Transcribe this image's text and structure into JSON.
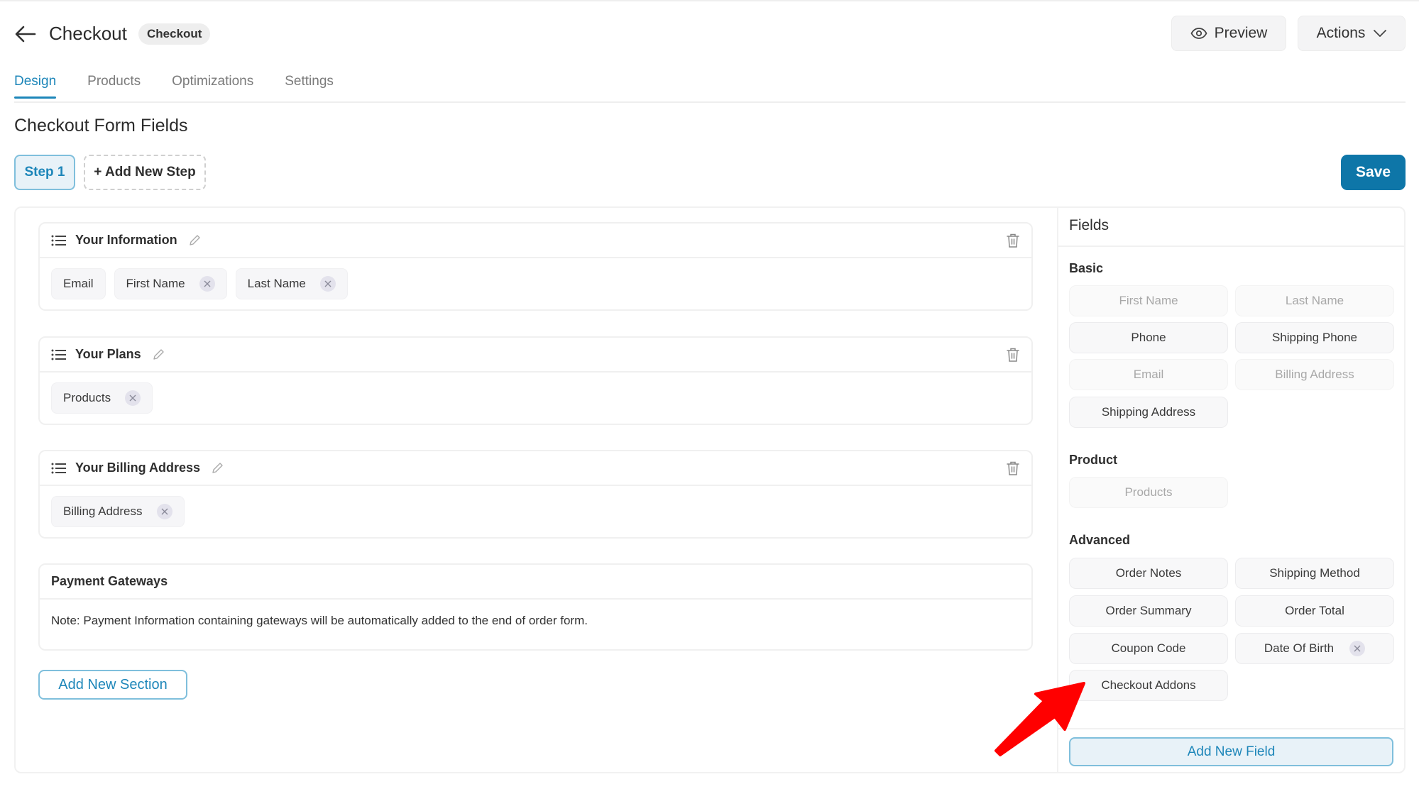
{
  "header": {
    "title": "Checkout",
    "badge": "Checkout",
    "preview_label": "Preview",
    "actions_label": "Actions"
  },
  "tabs": [
    {
      "label": "Design",
      "active": true
    },
    {
      "label": "Products",
      "active": false
    },
    {
      "label": "Optimizations",
      "active": false
    },
    {
      "label": "Settings",
      "active": false
    }
  ],
  "form": {
    "heading": "Checkout Form Fields",
    "step_label": "Step 1",
    "add_step_label": "+ Add New Step",
    "save_label": "Save",
    "sections": [
      {
        "title": "Your Information",
        "fields": [
          {
            "label": "Email",
            "removable": false
          },
          {
            "label": "First Name",
            "removable": true
          },
          {
            "label": "Last Name",
            "removable": true
          }
        ]
      },
      {
        "title": "Your Plans",
        "fields": [
          {
            "label": "Products",
            "removable": true
          }
        ]
      },
      {
        "title": "Your Billing Address",
        "fields": [
          {
            "label": "Billing Address",
            "removable": true
          }
        ]
      }
    ],
    "payment": {
      "title": "Payment Gateways",
      "note": "Note: Payment Information containing gateways will be automatically added to the end of order form."
    },
    "add_section_label": "Add New Section"
  },
  "fields_panel": {
    "title": "Fields",
    "groups": [
      {
        "label": "Basic",
        "items": [
          {
            "label": "First Name",
            "disabled": true
          },
          {
            "label": "Last Name",
            "disabled": true
          },
          {
            "label": "Phone",
            "disabled": false
          },
          {
            "label": "Shipping Phone",
            "disabled": false
          },
          {
            "label": "Email",
            "disabled": true
          },
          {
            "label": "Billing Address",
            "disabled": true
          },
          {
            "label": "Shipping Address",
            "disabled": false
          }
        ]
      },
      {
        "label": "Product",
        "items": [
          {
            "label": "Products",
            "disabled": true
          }
        ]
      },
      {
        "label": "Advanced",
        "items": [
          {
            "label": "Order Notes",
            "disabled": false
          },
          {
            "label": "Shipping Method",
            "disabled": false
          },
          {
            "label": "Order Summary",
            "disabled": false
          },
          {
            "label": "Order Total",
            "disabled": false
          },
          {
            "label": "Coupon Code",
            "disabled": false
          },
          {
            "label": "Date Of Birth",
            "disabled": false,
            "removable": true
          },
          {
            "label": "Checkout Addons",
            "disabled": false
          }
        ]
      }
    ],
    "add_field_label": "Add New Field"
  },
  "colors": {
    "accent": "#1d86b9",
    "save": "#0e76a8",
    "annotation_arrow": "#ff0000"
  }
}
